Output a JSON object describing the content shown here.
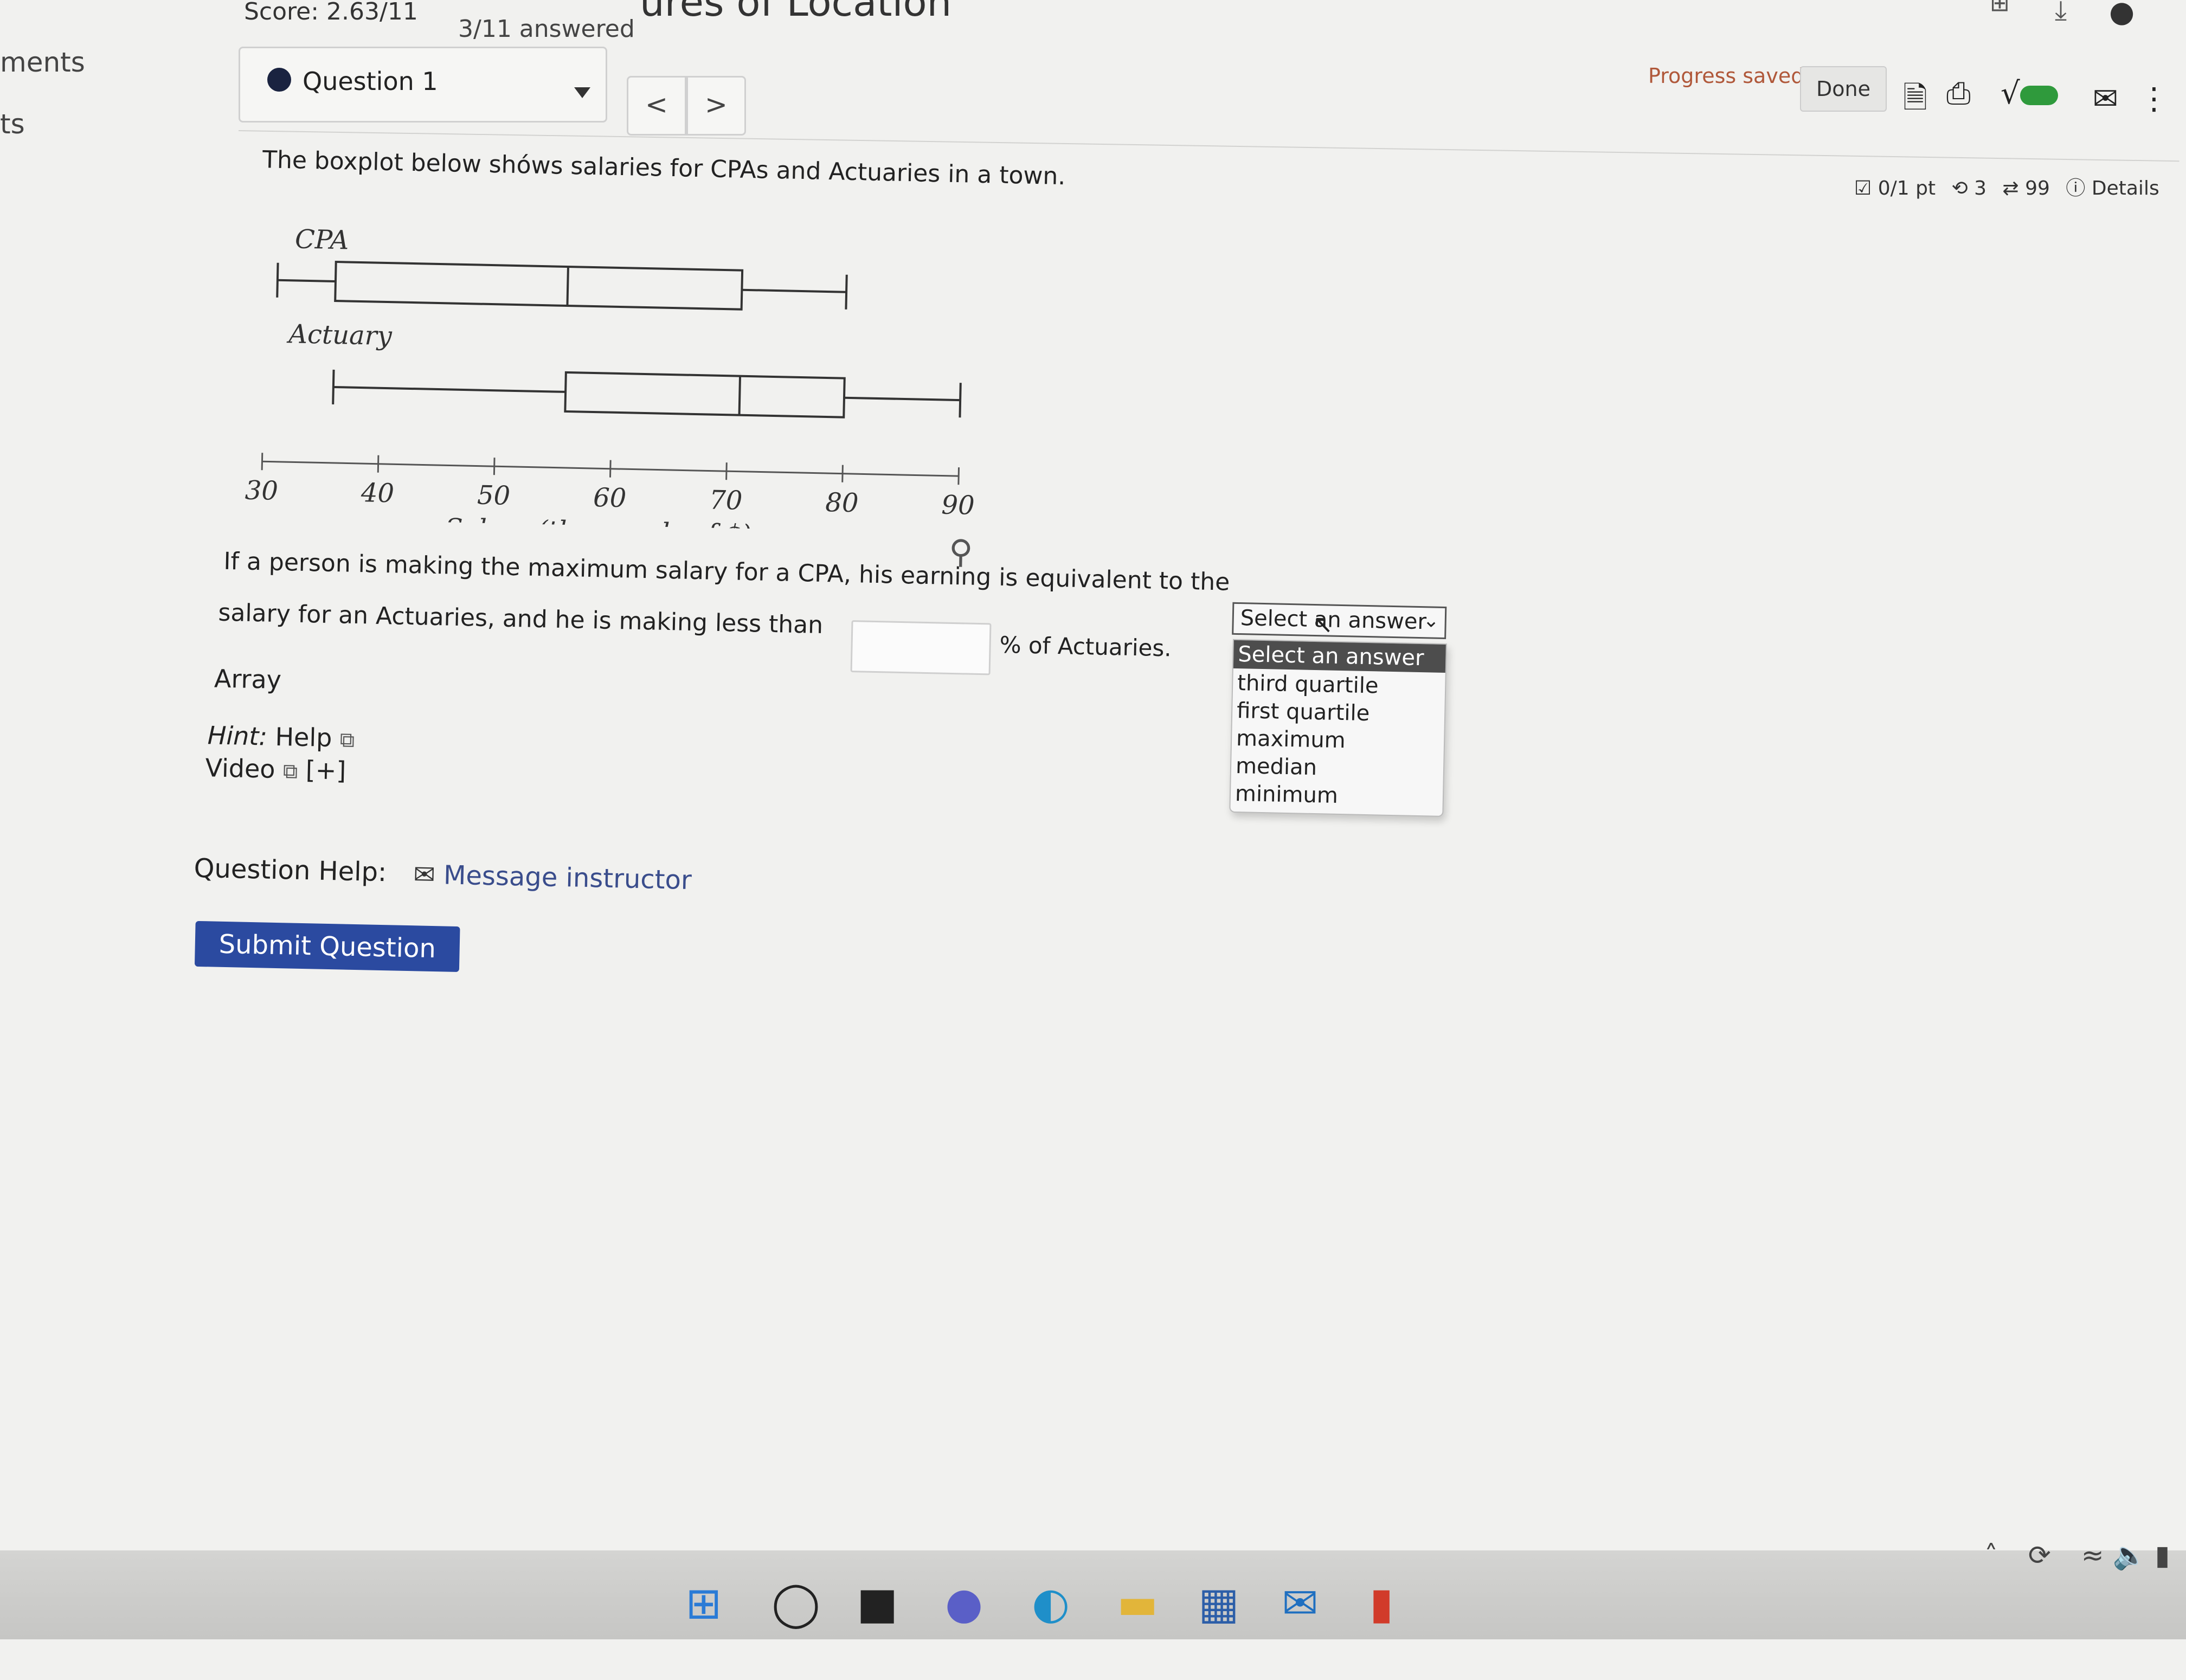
{
  "header": {
    "score": "Score: 2.63/11",
    "answered": "3/11 answered",
    "title": "ures of Location",
    "left_nav": [
      "ments",
      "ts"
    ]
  },
  "question_nav": {
    "current": "Question 1",
    "prev": "<",
    "next": ">"
  },
  "toolbar": {
    "progress": "Progress saved",
    "done": "Done",
    "points": "0/1 pt",
    "retries": "3",
    "attempts": "99",
    "details": "Details"
  },
  "question": {
    "intro": "The boxplot below shóws salaries for CPAs and Actuaries in a town.",
    "line1": "If a person is making the maximum salary for a CPA, his earning is equivalent to the",
    "line2a": "salary for an Actuaries, and he is making less than",
    "line2b": "% of Actuaries.",
    "array": "Array",
    "hint_label": "Hint:",
    "hint_link": "Help",
    "video_link": "Video",
    "video_expand": "[+]",
    "help_label": "Question Help:",
    "message": "Message instructor",
    "submit": "Submit Question",
    "select_value": "Select an answer",
    "options": [
      "Select an answer",
      "third quartile",
      "first quartile",
      "maximum",
      "median",
      "minimum"
    ]
  },
  "chart_data": {
    "type": "boxplot",
    "xlabel": "Salary (thousands of $)",
    "xlim": [
      30,
      90
    ],
    "ticks": [
      30,
      40,
      50,
      60,
      70,
      80,
      90
    ],
    "tick_labels": [
      "30",
      "40",
      "50",
      "60",
      "70",
      "80",
      "90"
    ],
    "series": [
      {
        "name": "CPA",
        "min": 31,
        "q1": 36,
        "median": 56,
        "q3": 71,
        "max": 80
      },
      {
        "name": "Actuary",
        "min": 36,
        "q1": 56,
        "median": 71,
        "q3": 80,
        "max": 90
      }
    ]
  }
}
